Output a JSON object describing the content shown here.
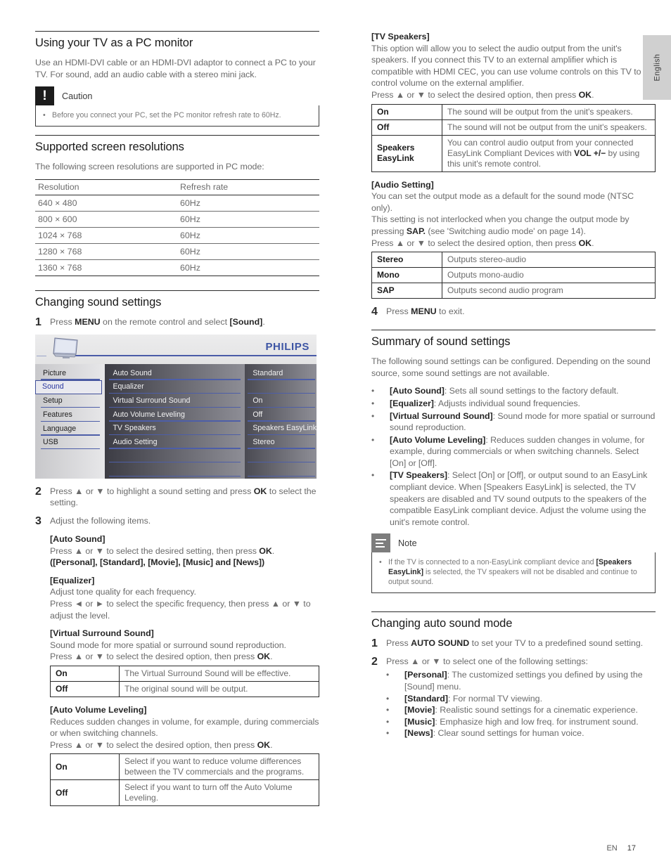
{
  "page": {
    "language_tab": "English",
    "footer_locale": "EN",
    "footer_page": "17"
  },
  "left_column": {
    "pc_monitor": {
      "heading": "Using your TV as a PC monitor",
      "intro": "Use an HDMI-DVI cable or an HDMI-DVI adaptor to connect a PC to your TV. For sound, add an audio cable with a stereo mini jack.",
      "caution": {
        "title": "Caution",
        "icon": "exclamation-icon",
        "bullet": "Before you connect your PC, set the PC monitor refresh rate to 60Hz."
      }
    },
    "resolutions": {
      "heading": "Supported screen resolutions",
      "intro": "The following screen resolutions are supported in PC mode:",
      "columns": [
        "Resolution",
        "Refresh rate"
      ],
      "rows": [
        [
          "640 × 480",
          "60Hz"
        ],
        [
          "800 × 600",
          "60Hz"
        ],
        [
          "1024 × 768",
          "60Hz"
        ],
        [
          "1280 × 768",
          "60Hz"
        ],
        [
          "1360 × 768",
          "60Hz"
        ]
      ]
    },
    "sound_settings": {
      "heading": "Changing sound settings",
      "step1_num": "1",
      "step1_text_a": "Press ",
      "step1_menu": "MENU",
      "step1_text_b": " on the remote control and select ",
      "step1_sound": "[Sound]",
      "step1_text_c": ".",
      "step2_num": "2",
      "step2_text_a": "Press ▲ or ▼ to highlight a sound setting and press ",
      "step2_ok": "OK",
      "step2_text_b": " to select the setting.",
      "step3_num": "3",
      "step3_text": "Adjust the following items.",
      "items": {
        "auto_sound": {
          "title": "[Auto Sound]",
          "line1_a": "Press ▲ or ▼ to select the desired setting, then press ",
          "line1_ok": "OK",
          "line1_b": ".",
          "line2": "([Personal], [Standard], [Movie], [Music] and [News])"
        },
        "equalizer": {
          "title": "[Equalizer]",
          "line1": "Adjust tone quality for each frequency.",
          "line2": "Press ◄ or ► to select the specific frequency, then press ▲ or ▼ to adjust the level."
        },
        "virtual_surround": {
          "title": "[Virtual Surround Sound]",
          "line1": "Sound mode for more spatial or surround sound reproduction.",
          "line2_a": "Press ▲ or ▼ to select the desired option, then press ",
          "line2_ok": "OK",
          "line2_b": ".",
          "table": [
            [
              "On",
              "The Virtual Surround Sound will be effective."
            ],
            [
              "Off",
              "The original sound will be output."
            ]
          ]
        },
        "auto_volume": {
          "title": "[Auto Volume Leveling]",
          "line1": "Reduces sudden changes in volume, for example, during commercials or when switching channels.",
          "line2_a": "Press ▲ or ▼ to select the desired option, then press ",
          "line2_ok": "OK",
          "line2_b": ".",
          "table": [
            [
              "On",
              "Select if you want to reduce volume differences between the TV commercials and the programs."
            ],
            [
              "Off",
              "Select if you want to turn off the Auto Volume Leveling."
            ]
          ]
        }
      }
    },
    "osd": {
      "brand": "PHILIPS",
      "tv_icon": "tv-screen-icon",
      "menu_left": [
        "Picture",
        "Sound",
        "Setup",
        "Features",
        "Language",
        "USB"
      ],
      "selected_left": "Sound",
      "menu_mid": [
        "Auto Sound",
        "Equalizer",
        "Virtual Surround Sound",
        "Auto Volume Leveling",
        "TV Speakers",
        "Audio Setting"
      ],
      "menu_right": [
        "Standard",
        "",
        "On",
        "Off",
        "Speakers EasyLink",
        "Stereo"
      ]
    }
  },
  "right_column": {
    "tv_speakers": {
      "title": "[TV Speakers]",
      "para1": "This option will allow you to select the audio output from the unit's speakers. If you connect this TV to an external amplifier which is compatible with HDMI CEC, you can use volume controls on this TV to control volume on the external amplifier.",
      "para2_a": "Press ▲ or ▼ to select the desired option, then press ",
      "para2_ok": "OK",
      "para2_b": ".",
      "table": [
        [
          "On",
          "The sound will be output from the unit's speakers."
        ],
        [
          "Off",
          "The sound will not be output from the unit's speakers."
        ]
      ],
      "row3_key": "Speakers EasyLink",
      "row3_val_a": "You can control audio output from your connected EasyLink Compliant Devices with ",
      "row3_val_vol": "VOL +/−",
      "row3_val_b": " by using this unit's remote control."
    },
    "audio_setting": {
      "title": "[Audio Setting]",
      "para1": "You can set the output mode as a default for the sound mode (NTSC only).",
      "para2_a": "This setting is not interlocked when you change the output mode by pressing ",
      "para2_sap": "SAP.",
      "para2_b": " (see 'Switching audio mode' on page 14).",
      "para3_a": "Press ▲ or ▼ to select the desired option, then press ",
      "para3_ok": "OK",
      "para3_b": ".",
      "table": [
        [
          "Stereo",
          "Outputs stereo-audio"
        ],
        [
          "Mono",
          "Outputs mono-audio"
        ],
        [
          "SAP",
          "Outputs second audio program"
        ]
      ]
    },
    "step4": {
      "num": "4",
      "text_a": "Press ",
      "menu": "MENU",
      "text_b": " to exit."
    },
    "summary": {
      "heading": "Summary of sound settings",
      "intro": "The following sound settings can be configured. Depending on the sound source, some sound settings are not available.",
      "bullets": [
        {
          "key": "[Auto Sound]",
          "rest": ": Sets all sound settings to the factory default."
        },
        {
          "key": "[Equalizer]",
          "rest": ": Adjusts individual sound frequencies."
        },
        {
          "key": "[Virtual Surround Sound]",
          "rest": ": Sound mode for more spatial or surround sound reproduction."
        },
        {
          "key": "[Auto Volume Leveling]",
          "rest": ": Reduces sudden changes in volume, for example, during commercials or when switching channels. Select [On] or [Off]."
        },
        {
          "key": "[TV Speakers]",
          "rest": ": Select [On] or [Off], or output sound to an EasyLink compliant device. When [Speakers EasyLink] is selected, the TV speakers are disabled and TV sound outputs to the speakers of the compatible EasyLink compliant device. Adjust the volume using the unit's remote control."
        }
      ],
      "note": {
        "title": "Note",
        "icon": "note-lines-icon",
        "bullet_a": "If the TV is connected to a non-EasyLink compliant device and ",
        "bullet_key": "[Speakers EasyLink]",
        "bullet_b": " is selected, the TV speakers will not be disabled and continue to output sound."
      }
    },
    "auto_sound_mode": {
      "heading": "Changing auto sound mode",
      "step1_num": "1",
      "step1_a": "Press ",
      "step1_key": "AUTO SOUND",
      "step1_b": " to set your TV to a predefined sound setting.",
      "step2_num": "2",
      "step2_text": "Press ▲ or ▼ to select one of the following settings:",
      "bullets": [
        {
          "key": "[Personal]",
          "rest": ": The customized settings you defined by using the [Sound] menu."
        },
        {
          "key": "[Standard]",
          "rest": ": For normal TV viewing."
        },
        {
          "key": "[Movie]",
          "rest": ": Realistic sound settings for a cinematic experience."
        },
        {
          "key": "[Music]",
          "rest": ": Emphasize high and low freq. for instrument sound."
        },
        {
          "key": "[News]",
          "rest": ": Clear sound settings for human voice."
        }
      ]
    }
  },
  "colors": {
    "philips_blue": "#3d55a4",
    "osd_line_blue": "#4d5ea8",
    "caution_icon_bg": "#1c1c1c",
    "note_icon_bg": "#7d7d7d",
    "body_text": "#6b6b6b",
    "heading_text": "#1a1a1a"
  }
}
